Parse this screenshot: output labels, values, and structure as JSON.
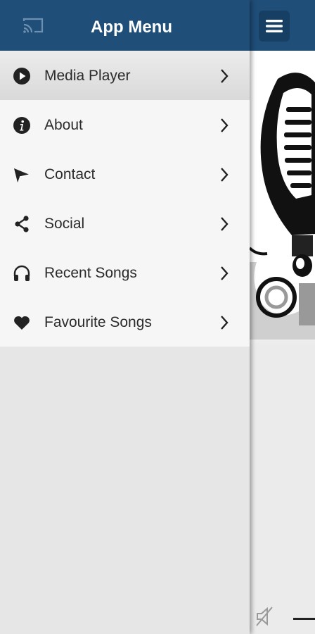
{
  "drawer": {
    "title": "App Menu",
    "cast_icon": "cast-icon",
    "items": [
      {
        "label": "Media Player",
        "icon": "play-circle-icon",
        "active": true
      },
      {
        "label": "About",
        "icon": "info-icon",
        "active": false
      },
      {
        "label": "Contact",
        "icon": "send-icon",
        "active": false
      },
      {
        "label": "Social",
        "icon": "share-icon",
        "active": false
      },
      {
        "label": "Recent Songs",
        "icon": "headphones-icon",
        "active": false
      },
      {
        "label": "Favourite Songs",
        "icon": "heart-icon",
        "active": false
      }
    ]
  },
  "main": {
    "menu_icon": "hamburger-icon",
    "artwork_icon": "microphone-artwork",
    "mute_icon": "volume-mute-icon"
  },
  "colors": {
    "header": "#1f4e79",
    "menu_button": "#173e63",
    "menu_item_bg": "#f6f6f6",
    "drawer_bg": "#e6e6e6",
    "text": "#2b2b2b"
  }
}
